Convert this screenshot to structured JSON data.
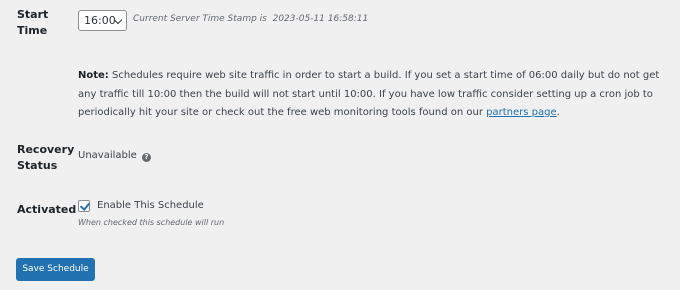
{
  "start_time": {
    "label_line1": "Start",
    "label_line2": "Time",
    "selected_value": "16:00",
    "server_stamp_prefix": "Current Server Time Stamp is",
    "server_stamp_value": "2023-05-11 16:58:11"
  },
  "note": {
    "prefix": "Note:",
    "text": "Schedules require web site traffic in order to start a build. If you set a start time of 06:00 daily but do not get any traffic till 10:00 then the build will not start until 10:00. If you have low traffic consider setting up a cron job to periodically hit your site or check out the free web monitoring tools found on our",
    "link_text": "partners page",
    "suffix": "."
  },
  "recovery": {
    "label_line1": "Recovery",
    "label_line2": "Status",
    "value": "Unavailable",
    "help_icon_glyph": "?"
  },
  "activated": {
    "label": "Activated",
    "checked": true,
    "checkbox_label": "Enable This Schedule",
    "description": "When checked this schedule will run"
  },
  "actions": {
    "save_label": "Save Schedule"
  },
  "colors": {
    "background": "#f0f0f1",
    "accent": "#2271b1",
    "text": "#1d2327",
    "muted": "#646970"
  }
}
